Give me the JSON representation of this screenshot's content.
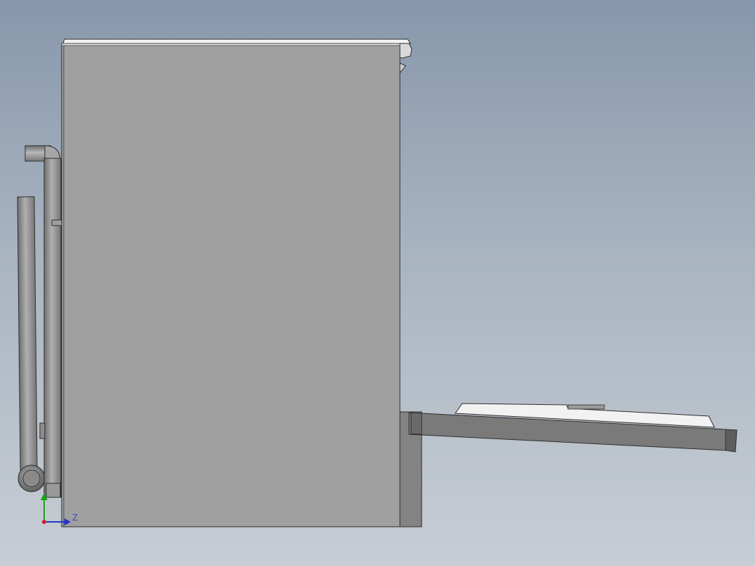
{
  "viewport": {
    "background_top": "#8797ab",
    "background_bottom": "#c7cdd4"
  },
  "model": {
    "body_color": "#a0a0a0",
    "edge_color": "#2e2e2e",
    "lid_color": "#f4f4f4",
    "pipe_color": "#8c8c8c",
    "tray_color": "#7a7a7a"
  },
  "triad": {
    "y_axis_color": "#1aa31a",
    "z_axis_color": "#2233cc",
    "origin_color": "#cc2222",
    "z_label": "Z"
  }
}
